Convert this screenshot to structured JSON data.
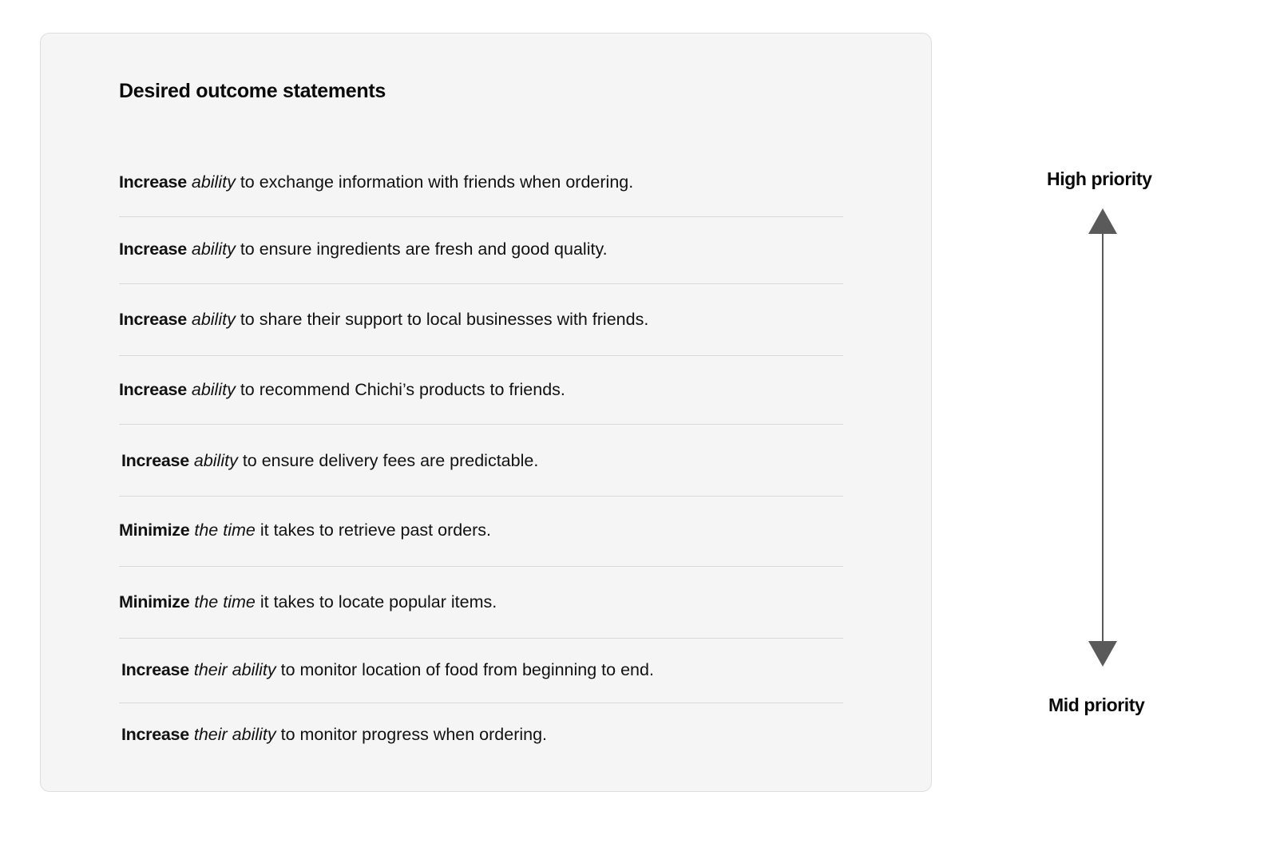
{
  "card": {
    "title": "Desired outcome statements",
    "statements": [
      {
        "verb": "Increase",
        "object": "ability",
        "rest": "to exchange information with friends when ordering."
      },
      {
        "verb": "Increase",
        "object": "ability",
        "rest": "to ensure ingredients are fresh and good quality."
      },
      {
        "verb": "Increase",
        "object": "ability",
        "rest": "to share their support to local businesses with friends."
      },
      {
        "verb": "Increase",
        "object": "ability",
        "rest": "to recommend Chichi’s products to friends."
      },
      {
        "verb": "Increase",
        "object": "ability",
        "rest": "to ensure delivery fees are predictable."
      },
      {
        "verb": "Minimize",
        "object": "the time",
        "rest": "it takes to retrieve past orders."
      },
      {
        "verb": "Minimize",
        "object": "the time",
        "rest": "it takes to locate popular items."
      },
      {
        "verb": "Increase",
        "object": "their ability",
        "rest": "to monitor location of food from beginning to end."
      },
      {
        "verb": "Increase",
        "object": "their ability",
        "rest": "to monitor progress when ordering."
      }
    ]
  },
  "priority_scale": {
    "top_label": "High priority",
    "bottom_label": "Mid priority",
    "arrow_color": "#5a5a5a"
  }
}
